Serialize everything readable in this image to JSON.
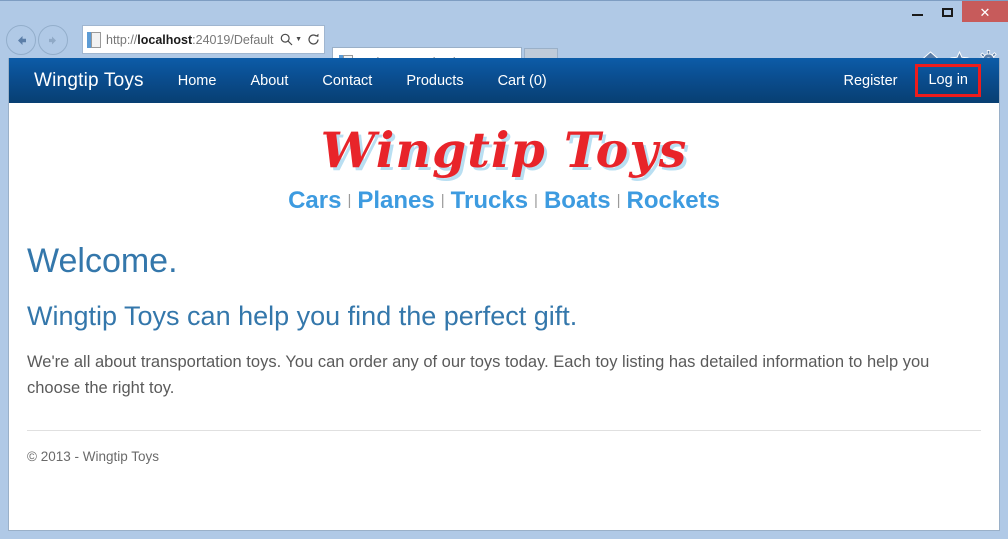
{
  "browser": {
    "window_controls": {
      "minimize": "minimize-icon",
      "maximize": "maximize-icon",
      "close": "✕"
    },
    "back_button": "back-arrow-icon",
    "forward_button": "forward-arrow-icon",
    "address": {
      "url_prefix": "http://",
      "url_host": "localhost",
      "url_suffix": ":24019/Default",
      "url_full": "http://localhost:24019/Default",
      "search_icon": "magnifier-icon",
      "dropdown_caret": "▼",
      "refresh_icon": "↻"
    },
    "tab": {
      "title": "Welcome - Wingtip Toys",
      "close_label": "✕",
      "favicon": "page-icon"
    },
    "new_tab_label": "",
    "toolbar_icons": [
      "home-icon",
      "favorites-star-icon",
      "settings-gear-icon"
    ]
  },
  "site": {
    "nav": {
      "brand": "Wingtip Toys",
      "links": [
        {
          "label": "Home"
        },
        {
          "label": "About"
        },
        {
          "label": "Contact"
        },
        {
          "label": "Products"
        },
        {
          "label": "Cart (0)"
        }
      ],
      "register_label": "Register",
      "login_label": "Log in",
      "highlight_color": "#ee1c1c",
      "bar_color_top": "#0c5ca8",
      "bar_color_bottom": "#083f72"
    },
    "logo": {
      "text": "Wingtip Toys",
      "color": "#e8242a",
      "shadow_color": "#b9dff2"
    },
    "categories": [
      {
        "label": "Cars"
      },
      {
        "label": "Planes"
      },
      {
        "label": "Trucks"
      },
      {
        "label": "Boats"
      },
      {
        "label": "Rockets"
      }
    ],
    "category_separator": "|",
    "category_color": "#3d9be0",
    "main": {
      "heading": "Welcome.",
      "subheading": "Wingtip Toys can help you find the perfect gift.",
      "paragraph": "We're all about transportation toys. You can order any of our toys today. Each toy listing has detailed information to help you choose the right toy.",
      "heading_color": "#3477ab"
    },
    "footer": {
      "copyright": "© 2013 - Wingtip Toys"
    }
  }
}
